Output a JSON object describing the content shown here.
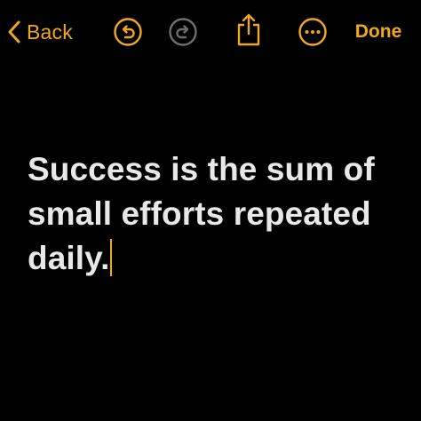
{
  "toolbar": {
    "back_label": "Back",
    "done_label": "Done",
    "icons": {
      "back": "chevron-left-icon",
      "undo": "undo-icon",
      "redo": "redo-icon",
      "share": "share-icon",
      "more": "more-icon"
    }
  },
  "note": {
    "text": "Success is the sum of small efforts repeated daily."
  },
  "colors": {
    "accent": "#f0a81c",
    "background": "#000000",
    "text": "#e8e8e8",
    "disabled": "#6e6e6e"
  }
}
